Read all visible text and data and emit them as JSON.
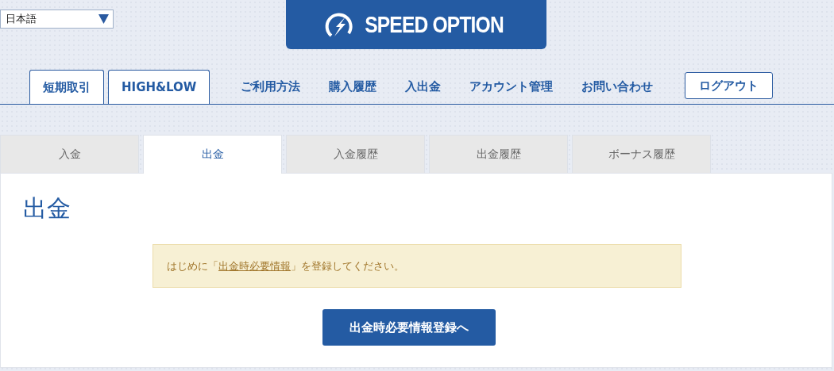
{
  "language_select": {
    "value": "日本語"
  },
  "logo": {
    "text": "SPEED OPTION"
  },
  "nav": [
    {
      "label": "短期取引",
      "kind": "boxed"
    },
    {
      "label": "HIGH&LOW",
      "kind": "boxed"
    },
    {
      "label": "ご利用方法",
      "kind": "plain"
    },
    {
      "label": "購入履歴",
      "kind": "plain"
    },
    {
      "label": "入出金",
      "kind": "plain"
    },
    {
      "label": "アカウント管理",
      "kind": "plain"
    },
    {
      "label": "お問い合わせ",
      "kind": "plain"
    },
    {
      "label": "ログアウト",
      "kind": "logout"
    }
  ],
  "tabs": [
    {
      "label": "入金",
      "selected": false
    },
    {
      "label": "出金",
      "selected": true
    },
    {
      "label": "入金履歴",
      "selected": false
    },
    {
      "label": "出金履歴",
      "selected": false
    },
    {
      "label": "ボーナス履歴",
      "selected": false
    }
  ],
  "page_title": "出金",
  "notice": {
    "before": "はじめに「",
    "link": "出金時必要情報",
    "after": "」を登録してください。"
  },
  "button": "出金時必要情報登録へ"
}
